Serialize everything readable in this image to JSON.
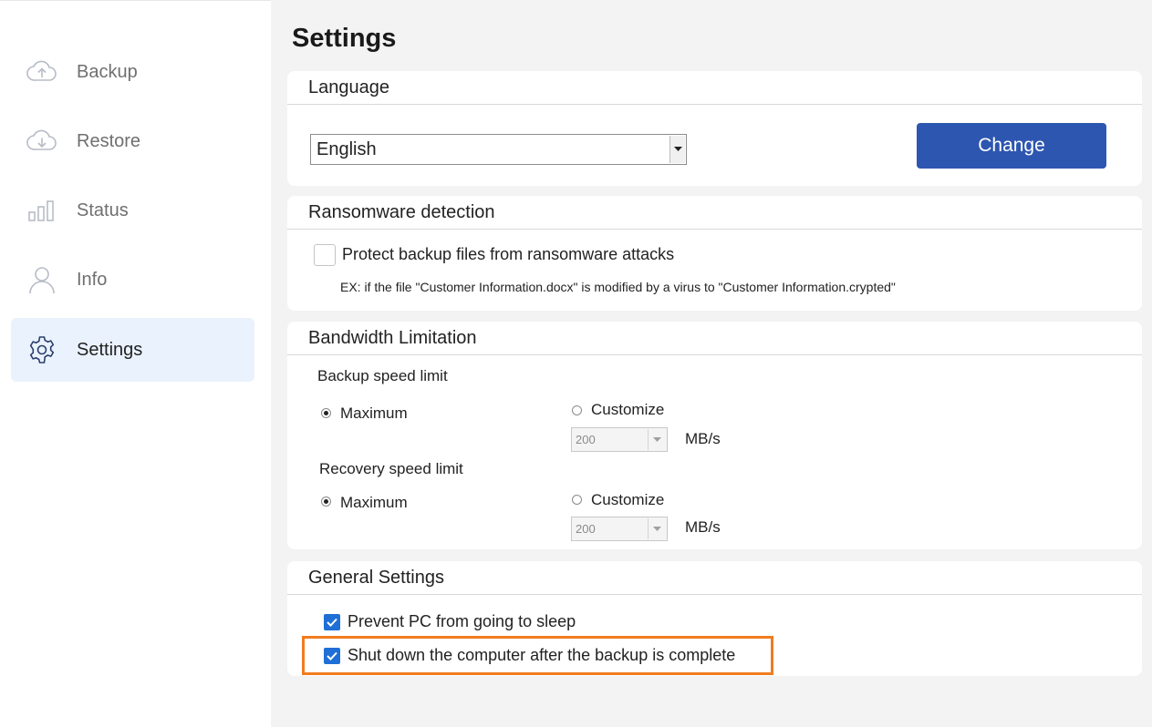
{
  "sidebar": {
    "items": [
      {
        "label": "Backup",
        "icon": "cloud-upload-icon",
        "active": false
      },
      {
        "label": "Restore",
        "icon": "cloud-download-icon",
        "active": false
      },
      {
        "label": "Status",
        "icon": "bar-chart-icon",
        "active": false
      },
      {
        "label": "Info",
        "icon": "user-icon",
        "active": false
      },
      {
        "label": "Settings",
        "icon": "gear-icon",
        "active": true
      }
    ]
  },
  "page": {
    "title": "Settings"
  },
  "language": {
    "header": "Language",
    "selected": "English",
    "change_label": "Change"
  },
  "ransomware": {
    "header": "Ransomware detection",
    "option_label": "Protect backup files from ransomware attacks",
    "option_checked": false,
    "example": "EX: if the file \"Customer Information.docx\" is modified by a virus to \"Customer Information.crypted\""
  },
  "bandwidth": {
    "header": "Bandwidth Limitation",
    "backup": {
      "title": "Backup speed limit",
      "maximum_label": "Maximum",
      "customize_label": "Customize",
      "selected": "Maximum",
      "value": "200",
      "unit": "MB/s"
    },
    "recovery": {
      "title": "Recovery speed limit",
      "maximum_label": "Maximum",
      "customize_label": "Customize",
      "selected": "Maximum",
      "value": "200",
      "unit": "MB/s"
    }
  },
  "general": {
    "header": "General Settings",
    "prevent_sleep_label": "Prevent PC from going to sleep",
    "prevent_sleep_checked": true,
    "shutdown_label": "Shut down the computer after the backup is complete",
    "shutdown_checked": true
  },
  "colors": {
    "accent": "#2d56b0",
    "checkbox": "#1f6fd6",
    "highlight": "#f07c1f",
    "active_nav_bg": "#eaf2fd"
  }
}
